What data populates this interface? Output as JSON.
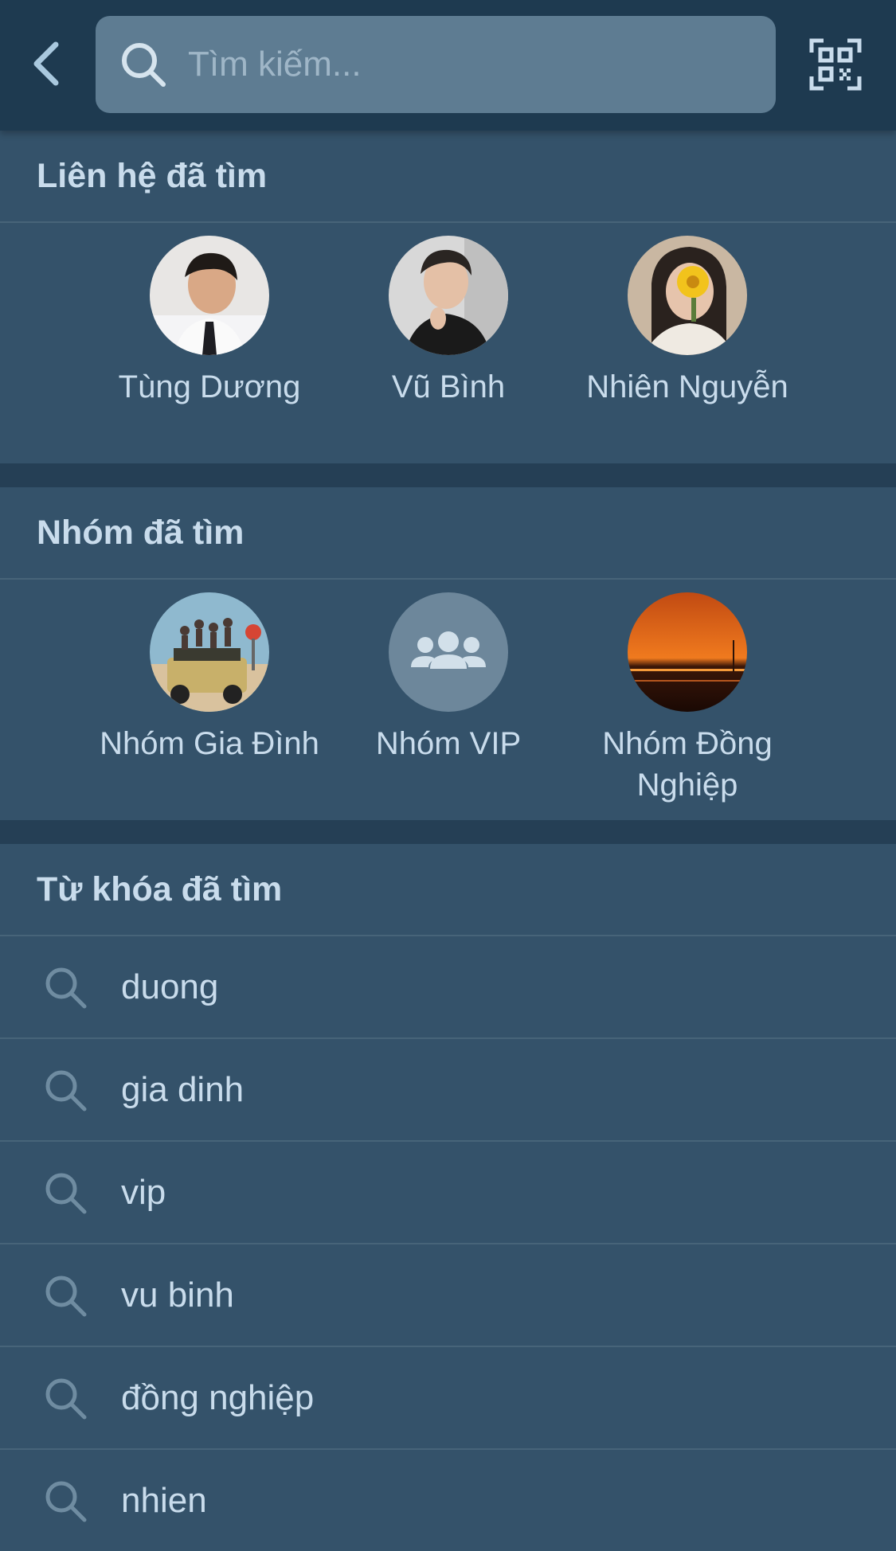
{
  "search": {
    "placeholder": "Tìm kiếm..."
  },
  "sections": {
    "contacts_title": "Liên hệ đã tìm",
    "groups_title": "Nhóm đã tìm",
    "keywords_title": "Từ khóa đã tìm"
  },
  "contacts": [
    {
      "name": "Tùng Dương",
      "avatar": "photo"
    },
    {
      "name": "Vũ Bình",
      "avatar": "photo"
    },
    {
      "name": "Nhiên Nguyễn",
      "avatar": "photo"
    }
  ],
  "groups": [
    {
      "name": "Nhóm Gia Đình",
      "avatar": "photo"
    },
    {
      "name": "Nhóm VIP",
      "avatar": "group-icon"
    },
    {
      "name": "Nhóm Đồng Nghiệp",
      "avatar": "photo"
    }
  ],
  "keywords": [
    "duong",
    "gia dinh",
    "vip",
    "vu binh",
    "đồng nghiệp",
    "nhien"
  ],
  "colors": {
    "background": "#34526a",
    "topbar": "#1e3a50",
    "search_field": "#5e7c92",
    "text": "#c9dcec",
    "divider": "#476479"
  }
}
